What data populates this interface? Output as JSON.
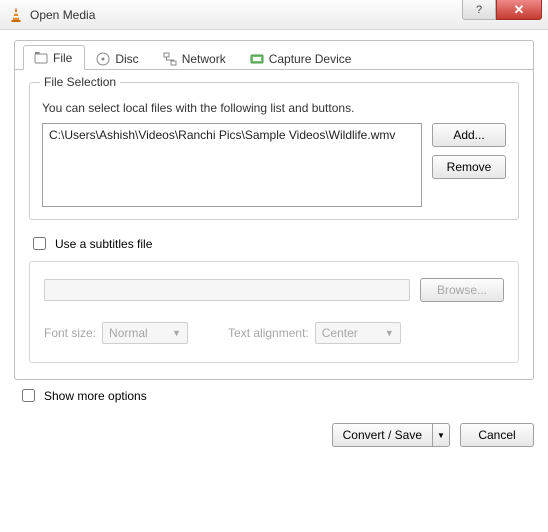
{
  "window": {
    "title": "Open Media"
  },
  "tabs": {
    "file": "File",
    "disc": "Disc",
    "network": "Network",
    "capture": "Capture Device"
  },
  "file_selection": {
    "group_title": "File Selection",
    "hint": "You can select local files with the following list and buttons.",
    "files": [
      "C:\\Users\\Ashish\\Videos\\Ranchi Pics\\Sample Videos\\Wildlife.wmv"
    ],
    "add_label": "Add...",
    "remove_label": "Remove"
  },
  "subtitles": {
    "checkbox_label": "Use a subtitles file",
    "browse_label": "Browse...",
    "font_size_label": "Font size:",
    "font_size_value": "Normal",
    "align_label": "Text alignment:",
    "align_value": "Center"
  },
  "more_options_label": "Show more options",
  "buttons": {
    "convert": "Convert / Save",
    "cancel": "Cancel"
  }
}
